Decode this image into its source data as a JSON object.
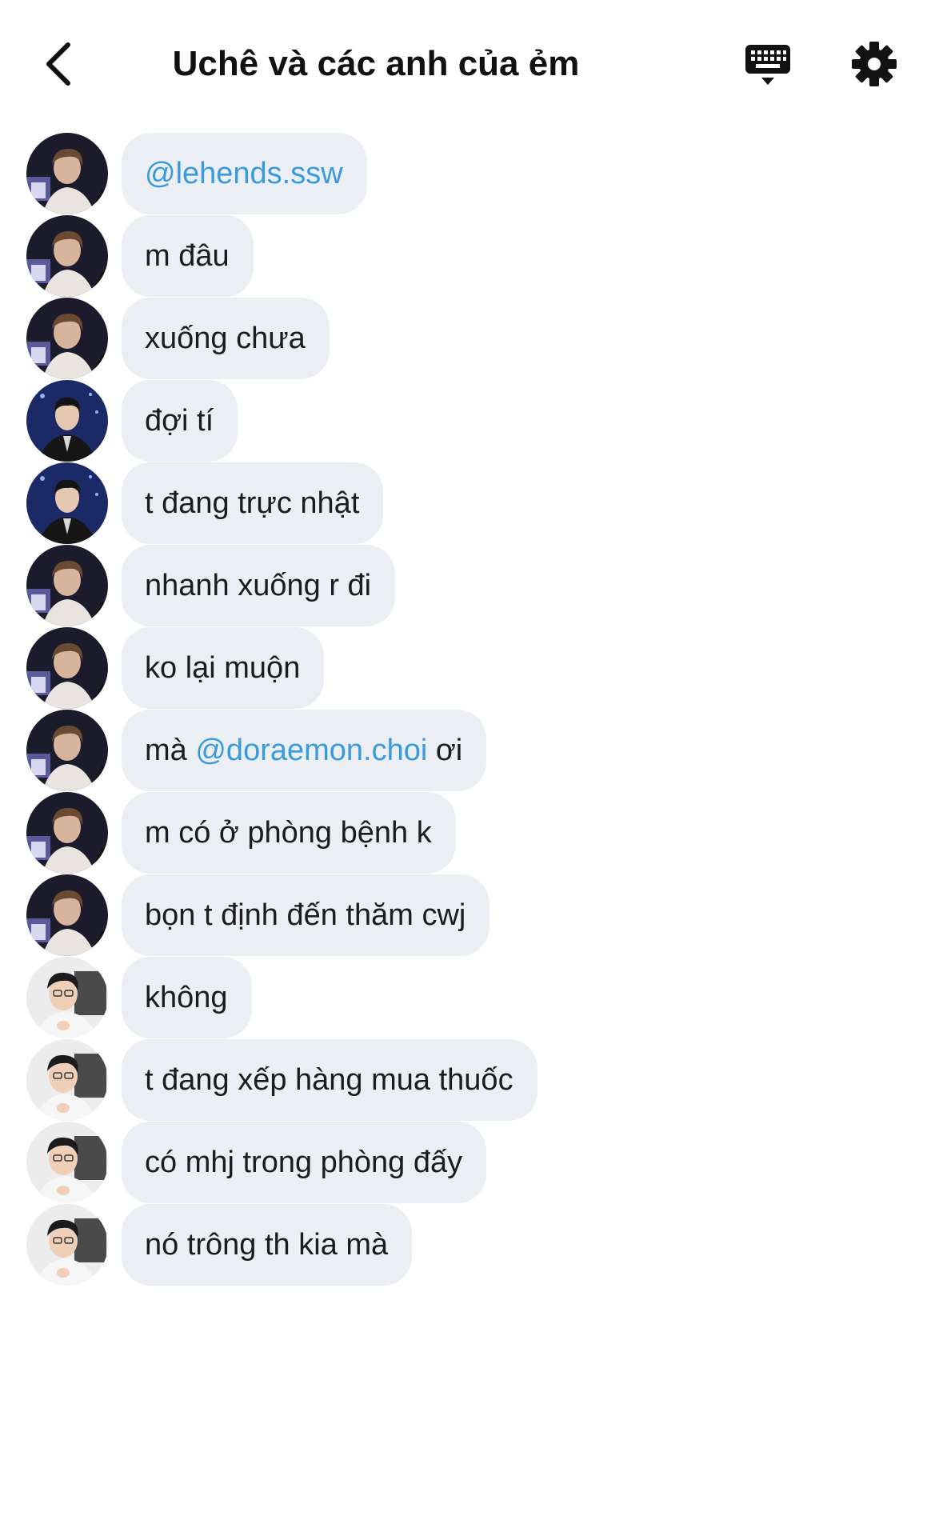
{
  "header": {
    "title": "Uchê và các anh của ẻm",
    "back_icon": "chevron-left-icon",
    "keyboard_icon": "keyboard-icon",
    "settings_icon": "gear-icon"
  },
  "colors": {
    "bubble_bg": "#ebeef2",
    "mention": "#3a9bdc"
  },
  "messages": [
    {
      "sender": "user1",
      "parts": [
        {
          "text": "@lehends.ssw",
          "mention": true
        }
      ]
    },
    {
      "sender": "user1",
      "parts": [
        {
          "text": "m đâu"
        }
      ]
    },
    {
      "sender": "user1",
      "parts": [
        {
          "text": "xuống chưa"
        }
      ]
    },
    {
      "sender": "user2",
      "parts": [
        {
          "text": "đợi tí"
        }
      ]
    },
    {
      "sender": "user2",
      "parts": [
        {
          "text": "t đang trực nhật"
        }
      ]
    },
    {
      "sender": "user1",
      "parts": [
        {
          "text": "nhanh xuống r đi"
        }
      ]
    },
    {
      "sender": "user1",
      "parts": [
        {
          "text": "ko lại muộn"
        }
      ]
    },
    {
      "sender": "user1",
      "parts": [
        {
          "text": "mà "
        },
        {
          "text": "@doraemon.choi",
          "mention": true
        },
        {
          "text": " ơi"
        }
      ]
    },
    {
      "sender": "user1",
      "parts": [
        {
          "text": "m có ở phòng bệnh k"
        }
      ]
    },
    {
      "sender": "user1",
      "parts": [
        {
          "text": "bọn t định đến thăm cwj"
        }
      ]
    },
    {
      "sender": "user3",
      "parts": [
        {
          "text": "không"
        }
      ]
    },
    {
      "sender": "user3",
      "parts": [
        {
          "text": "t đang xếp hàng mua thuốc"
        }
      ]
    },
    {
      "sender": "user3",
      "parts": [
        {
          "text": "có mhj trong phòng đấy"
        }
      ]
    },
    {
      "sender": "user3",
      "parts": [
        {
          "text": "nó trông th kia mà"
        }
      ]
    }
  ]
}
